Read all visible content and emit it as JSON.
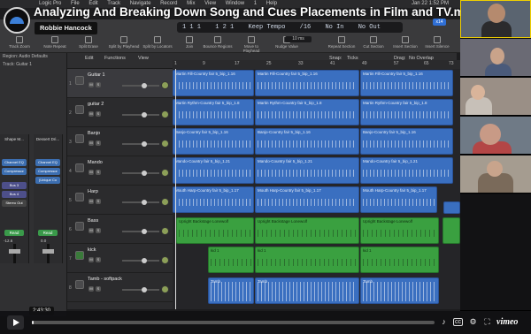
{
  "video": {
    "title": "Analyzing And Breaking Down Song and Cues Placements in Film and TV.mov",
    "channel": "Robbie Hancock",
    "current_time": "2:43:30",
    "progress_fraction": 0.005,
    "brand": "vimeo"
  },
  "menubar": {
    "items": [
      "Logic Pro",
      "File",
      "Edit",
      "Track",
      "Navigate",
      "Record",
      "Mix",
      "View",
      "Window",
      "1",
      "Help"
    ],
    "clock": "Jan 22 1:52 PM"
  },
  "lcd": {
    "bar": "1  1  1",
    "sub": "1  2  1",
    "tempo": "Keep Tempo",
    "sig": "/16",
    "in": "No In",
    "out": "No Out",
    "value": "10 ms",
    "badge": "x14"
  },
  "toolbar": [
    "Track Zoom",
    "Note Repeat",
    "Split Erase",
    "Split by Playhead",
    "Split by Locators",
    "Join",
    "Bounce Regions",
    "Move to Playhead",
    "Nudge Value",
    "Repeat Section",
    "Cut Section",
    "Insert Section",
    "Insert Silence"
  ],
  "inspector": {
    "region_label": "Region: Audio Defaults",
    "track_label": "Track: Guitar 1",
    "strips": [
      {
        "name": "Shape M...",
        "plugins": [
          "Channel EQ",
          "Compressor"
        ],
        "sends": [
          "Bus 3",
          "Bus 4"
        ],
        "out": "Stereo Out",
        "mode": "Read",
        "vol": "-12.6"
      },
      {
        "name": "Dessert Dri...",
        "plugins": [
          "Channel EQ",
          "Compressor",
          "(Unique Co"
        ],
        "sends": [],
        "out": "",
        "mode": "Read",
        "vol": "0.0"
      }
    ]
  },
  "list_header": {
    "edit": "Edit",
    "functions": "Functions",
    "view": "View",
    "snap_label": "Snap:",
    "snap": "Ticks",
    "drag_label": "Drag:",
    "drag": "No Overlap"
  },
  "ruler": [
    "1",
    "9",
    "17",
    "25",
    "33",
    "41",
    "49",
    "57",
    "65",
    "73"
  ],
  "tracks": [
    {
      "num": "1",
      "name": "Guitar 1",
      "selected": true
    },
    {
      "num": "2",
      "name": "guitar 2",
      "selected": false
    },
    {
      "num": "3",
      "name": "Banjo",
      "selected": false
    },
    {
      "num": "4",
      "name": "Mando",
      "selected": false
    },
    {
      "num": "5",
      "name": "Harp",
      "selected": false
    },
    {
      "num": "6",
      "name": "Bass",
      "selected": false
    },
    {
      "num": "7",
      "name": "kick",
      "selected": false
    },
    {
      "num": "8",
      "name": "Tamb - softpack",
      "selected": false
    }
  ],
  "region_labels": {
    "guitar1": "Martin Fill-Country fair 5_bip_1.16",
    "guitar2": "Martin Rythm-Country fair 5_bip_1.8",
    "banjo": "Banjo-Country fair 5_bip_1.16",
    "mando": "Mando-Country fair 5_bip_1.21",
    "harp": "Mouth Harp-Country fair 5_bip_1.17",
    "bass": "Upright Backstage Lonewolf",
    "kick": "kid 1",
    "tamb": "Tamb"
  },
  "colors": {
    "audio_region": "#3a6fc0",
    "midi_region": "#3aa040",
    "accent": "#2f6fd6"
  }
}
